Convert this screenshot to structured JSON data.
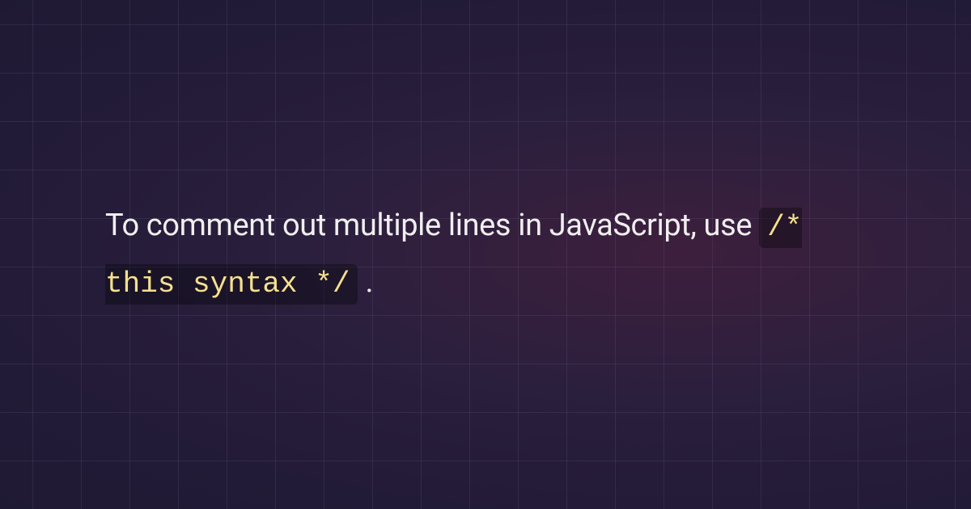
{
  "content": {
    "text_before": "To comment out multiple lines in JavaScript, use ",
    "code": "/* this syntax */",
    "text_after": " ."
  }
}
